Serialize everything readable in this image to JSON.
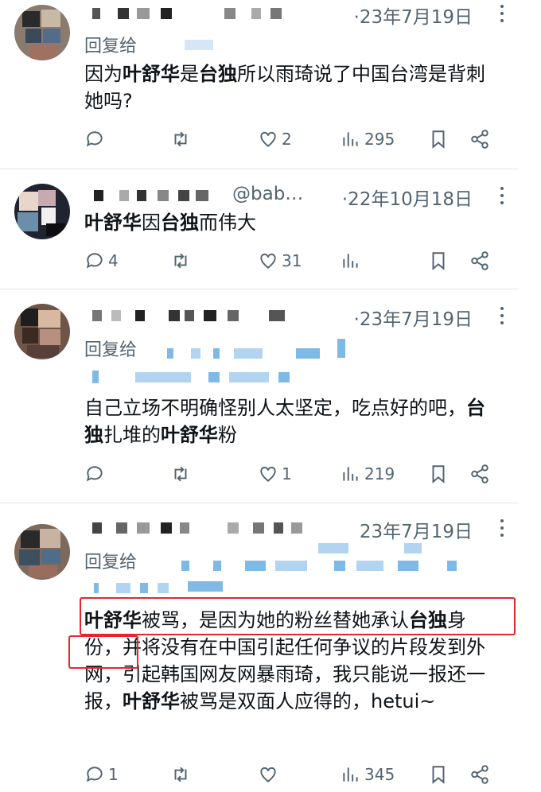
{
  "posts": [
    {
      "date": "·23年7月19日",
      "reply_label": "回复给",
      "text_parts": [
        "因为",
        "叶舒华",
        "是",
        "台独",
        "所以雨琦说了中国台湾是背刺她吗?"
      ],
      "actions": {
        "reply": "",
        "retweet": "",
        "like": "2",
        "views": "295"
      }
    },
    {
      "handle": "@bab…",
      "date": "·22年10月18日",
      "text_parts": [
        "叶舒华",
        "因",
        "台独",
        "而伟大"
      ],
      "actions": {
        "reply": "4",
        "retweet": "",
        "like": "31",
        "views": ""
      }
    },
    {
      "date": "·23年7月19日",
      "reply_label": "回复给",
      "text_parts": [
        "自己立场不明确怪别人太坚定，吃点好的吧，",
        "台独",
        "扎堆的",
        "叶舒华",
        "粉"
      ],
      "actions": {
        "reply": "",
        "retweet": "",
        "like": "1",
        "views": "219"
      }
    },
    {
      "date": "23年7月19日",
      "reply_label": "回复给",
      "text_parts": [
        "叶舒华",
        "被骂，是因为她的粉丝替她承认",
        "台独",
        "身份",
        "，并将没有在中国引起任何争议的片段发到外网，引起韩国网友网暴雨琦，我只能说一报还一报，",
        "叶舒华",
        "被骂是双面人应得的，hetui~"
      ],
      "actions": {
        "reply": "1",
        "retweet": "",
        "like": "",
        "views": "345"
      }
    }
  ],
  "icons": [
    "reply-icon",
    "retweet-icon",
    "like-icon",
    "views-icon",
    "bookmark-icon",
    "share-icon",
    "more-icon"
  ],
  "colors": {
    "text": "#0f1419",
    "secondary": "#536471",
    "highlight": "#e8262a"
  }
}
